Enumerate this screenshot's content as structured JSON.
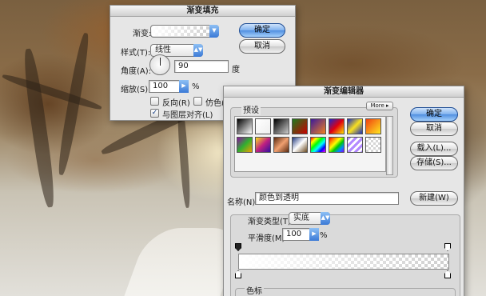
{
  "gradient_fill": {
    "title": "渐变填充",
    "gradient_label": "渐变:",
    "style_label": "样式(T):",
    "style_value": "线性",
    "angle_label": "角度(A):",
    "angle_value": "90",
    "angle_unit": "度",
    "scale_label": "缩放(S):",
    "scale_value": "100",
    "scale_unit": "%",
    "reverse_label": "反向(R)",
    "dither_label": "仿色(",
    "align_label": "与图层对齐(L)",
    "ok_label": "确定",
    "cancel_label": "取消",
    "reverse_checked": false,
    "dither_checked": false,
    "align_checked": true
  },
  "gradient_editor": {
    "title": "渐变编辑器",
    "presets_label": "预设",
    "more_label": "More ▸",
    "ok_label": "确定",
    "cancel_label": "取消",
    "load_label": "载入(L)...",
    "save_label": "存储(S)...",
    "name_label": "名称(N):",
    "name_value": "颜色到透明",
    "new_label": "新建(W)",
    "type_label": "渐变类型(T):",
    "type_value": "实底",
    "smooth_label": "平滑度(M):",
    "smooth_value": "100",
    "smooth_unit": "%",
    "color_stops_label": "色标",
    "presets": [
      {
        "name": "black-white",
        "css": "linear-gradient(135deg,#000,#fff)"
      },
      {
        "name": "white-transparent",
        "css": "linear-gradient(135deg,#fff,#eee)"
      },
      {
        "name": "black-transparent",
        "css": "linear-gradient(135deg,#000,#ccc)"
      },
      {
        "name": "green-red",
        "css": "linear-gradient(135deg,#1d7a1d,#c80000)"
      },
      {
        "name": "violet-orange",
        "css": "linear-gradient(135deg,#3a1a9a,#f08020)"
      },
      {
        "name": "blue-red-yellow",
        "css": "linear-gradient(135deg,#1c28c8,#e00010,#ffe000)"
      },
      {
        "name": "blue-yellow-blue",
        "css": "linear-gradient(135deg,#1a2dbb,#f8e020,#1a2dbb)"
      },
      {
        "name": "orange-yellow",
        "css": "linear-gradient(135deg,#f04010,#ffe820)"
      },
      {
        "name": "violet-green",
        "css": "linear-gradient(135deg,#8a10a0,#30b030,#f0a000)"
      },
      {
        "name": "yellow-violet",
        "css": "linear-gradient(135deg,#f8e020,#c02080,#3010a0)"
      },
      {
        "name": "copper",
        "css": "linear-gradient(135deg,#5a2a10,#f0a070,#5a2a10)"
      },
      {
        "name": "chrome",
        "css": "linear-gradient(135deg,#223a80,#ffffff 50%,#6a4a20)"
      },
      {
        "name": "spectrum",
        "css": "linear-gradient(135deg,#f00,#ff0,#0f0,#0ff,#00f,#f0f)"
      },
      {
        "name": "transparent-rainbow",
        "css": "linear-gradient(135deg,#f00,#f80,#ff0,#0c0,#08f,#80f)"
      },
      {
        "name": "transparent-stripes",
        "css": "repeating-linear-gradient(135deg,#b38aff 0 3px,#ffffff 3px 6px)"
      },
      {
        "name": "transparent",
        "css": "repeating-conic-gradient(#d6d6d6 0 25%,#ffffff 0 50%) 0 0/6px 6px"
      }
    ]
  },
  "colors": {
    "accent_button": "#5a96e6",
    "dialog_bg": "#e6e6e6"
  }
}
